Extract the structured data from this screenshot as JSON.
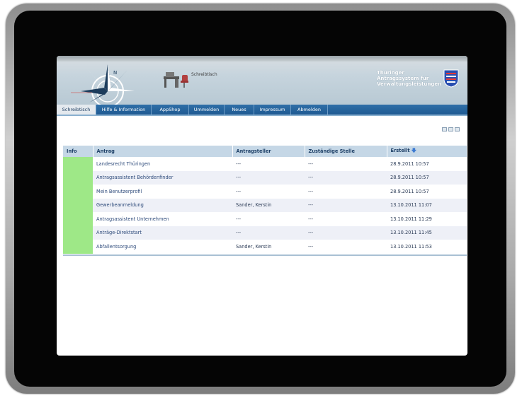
{
  "header": {
    "desk_label": "Schreibtisch",
    "brand_lines": [
      "Thüringer",
      "Antragssystem für",
      "Verwaltungsleistungen"
    ]
  },
  "nav": {
    "items": [
      {
        "label": "Schreibtisch",
        "active": true
      },
      {
        "label": "Hilfe & Information",
        "active": false
      },
      {
        "label": "AppShop",
        "active": false
      },
      {
        "label": "Ummelden",
        "active": false
      },
      {
        "label": "Neues",
        "active": false
      },
      {
        "label": "Impressum",
        "active": false
      },
      {
        "label": "Abmelden",
        "active": false
      }
    ]
  },
  "table": {
    "headers": {
      "info": "Info",
      "antrag": "Antrag",
      "antragsteller": "Antragsteller",
      "stelle": "Zuständige Stelle",
      "erstellt": "Erstellt"
    },
    "rows": [
      {
        "antrag": "Landesrecht Thüringen",
        "antragsteller": "---",
        "stelle": "---",
        "erstellt": "28.9.2011 10:57"
      },
      {
        "antrag": "Antragsassistent Behördenfinder",
        "antragsteller": "---",
        "stelle": "---",
        "erstellt": "28.9.2011 10:57"
      },
      {
        "antrag": "Mein Benutzerprofil",
        "antragsteller": "---",
        "stelle": "---",
        "erstellt": "28.9.2011 10:57"
      },
      {
        "antrag": "Gewerbeanmeldung",
        "antragsteller": "Sander, Kerstin",
        "stelle": "---",
        "erstellt": "13.10.2011 11:07"
      },
      {
        "antrag": "Antragsassistent Unternehmen",
        "antragsteller": "---",
        "stelle": "---",
        "erstellt": "13.10.2011 11:29"
      },
      {
        "antrag": "Anträge-Direktstart",
        "antragsteller": "---",
        "stelle": "---",
        "erstellt": "13.10.2011 11:45"
      },
      {
        "antrag": "Abfallentsorgung",
        "antragsteller": "Sander, Kerstin",
        "stelle": "---",
        "erstellt": "13.10.2011 11:53"
      }
    ]
  },
  "colors": {
    "info_green": "#9ee887",
    "nav_blue": "#1f5a92",
    "header_blue": "#c5d7e6"
  }
}
